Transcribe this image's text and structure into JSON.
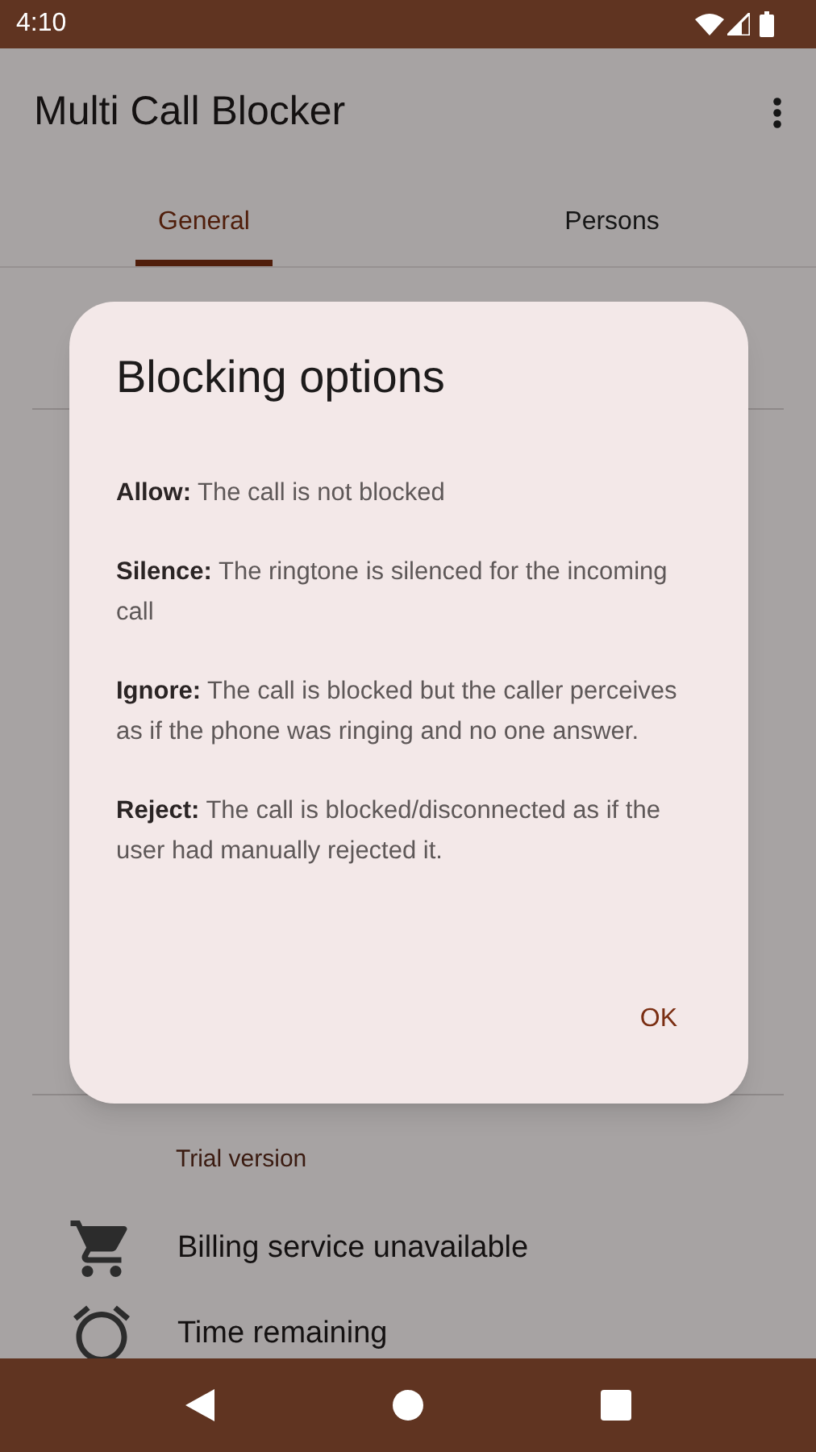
{
  "status_bar": {
    "time": "4:10"
  },
  "app_bar": {
    "title": "Multi Call Blocker"
  },
  "tabs": [
    {
      "label": "General",
      "selected": true
    },
    {
      "label": "Persons",
      "selected": false
    }
  ],
  "background": {
    "section_header": "Trial version",
    "items": [
      {
        "kind": "cart",
        "text": "Billing service unavailable"
      },
      {
        "kind": "alarm",
        "text": "Time remaining"
      }
    ]
  },
  "dialog": {
    "title": "Blocking options",
    "paragraphs": [
      "**Allow:** The call is not blocked",
      "**Silence:** The ringtone is silenced for the incoming call",
      "**Ignore:** The call is blocked but the caller perceives as if the phone was ringing and no one answer.",
      "**Reject:** The call is blocked/disconnected as if the user had manually rejected it."
    ],
    "button": "OK"
  }
}
